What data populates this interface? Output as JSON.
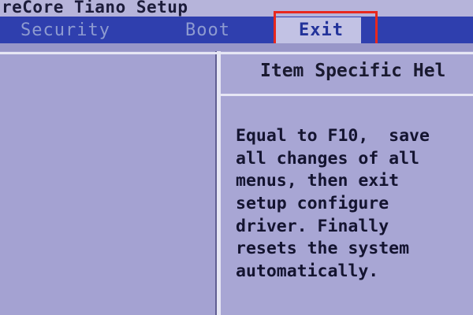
{
  "title_bar": {
    "text": "reCore Tiano Setup"
  },
  "tabs": [
    {
      "label": "Security",
      "active": false
    },
    {
      "label": "Boot",
      "active": false
    },
    {
      "label": "Exit",
      "active": true
    }
  ],
  "help_panel": {
    "title": "Item Specific Hel",
    "lines": [
      "Equal to F10,  save",
      "all changes of all",
      "menus, then exit",
      "setup configure",
      "driver. Finally",
      "resets the system",
      "automatically."
    ]
  },
  "colors": {
    "menu_bar": "#2f3fae",
    "active_tab": "#c2c2e4",
    "panel": "#a4a2d2",
    "highlight_box": "#e8281e"
  }
}
